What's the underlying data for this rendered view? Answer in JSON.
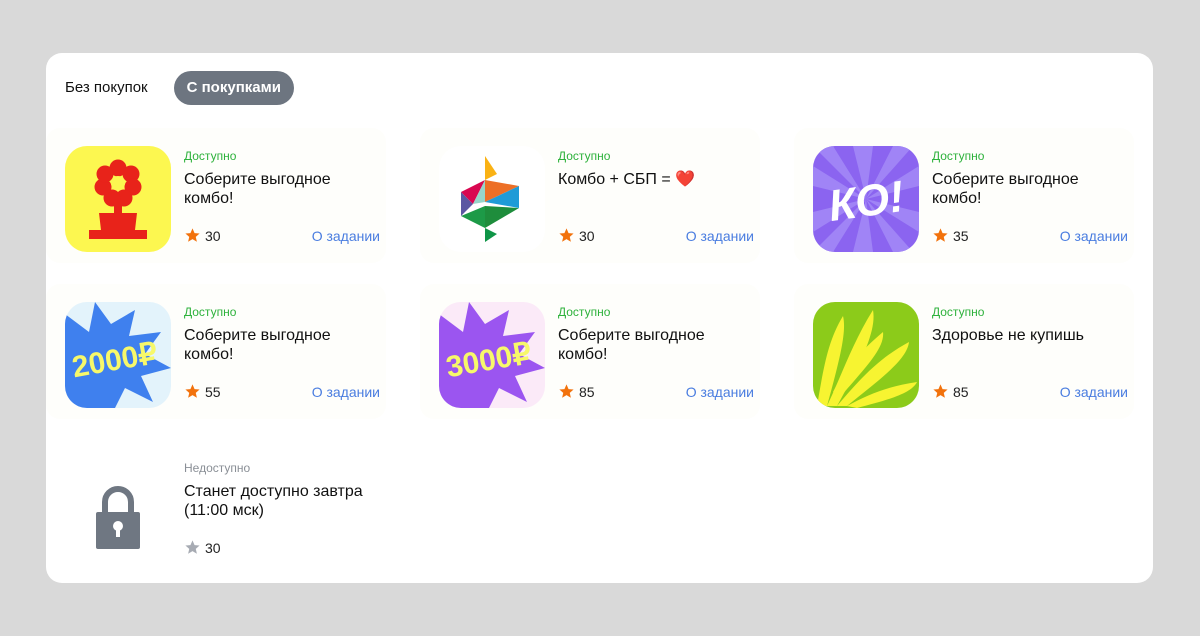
{
  "tabs": [
    {
      "label": "Без покупок",
      "active": false
    },
    {
      "label": "С покупками",
      "active": true
    }
  ],
  "more_label": "О задании",
  "accent_colors": {
    "available": "#2eb23c",
    "link": "#4a7de0",
    "star": "#f2720c",
    "star_disabled": "#a7abb3"
  },
  "tasks": [
    {
      "status": "Доступно",
      "title": "Соберите выгодное комбо!",
      "points": "30",
      "icon": "flower-icon"
    },
    {
      "status": "Доступно",
      "title": "Комбо + СБП = ❤️",
      "points": "30",
      "icon": "sbp-logo-icon"
    },
    {
      "status": "Доступно",
      "title": "Соберите выгодное комбо!",
      "points": "35",
      "icon": "ko-logo-icon",
      "icon_text": "КО!"
    },
    {
      "status": "Доступно",
      "title": "Соберите выгодное комбо!",
      "points": "55",
      "icon": "2000-rubles-icon",
      "icon_text": "2000₽"
    },
    {
      "status": "Доступно",
      "title": "Соберите выгодное комбо!",
      "points": "85",
      "icon": "3000-rubles-icon",
      "icon_text": "3000₽"
    },
    {
      "status": "Доступно",
      "title": "Здоровье не купишь",
      "points": "85",
      "icon": "yellow-leaves-icon"
    },
    {
      "status": "Недоступно",
      "title": "Станет доступно завтра (11:00 мск)",
      "points": "30",
      "icon": "lock-icon"
    }
  ]
}
